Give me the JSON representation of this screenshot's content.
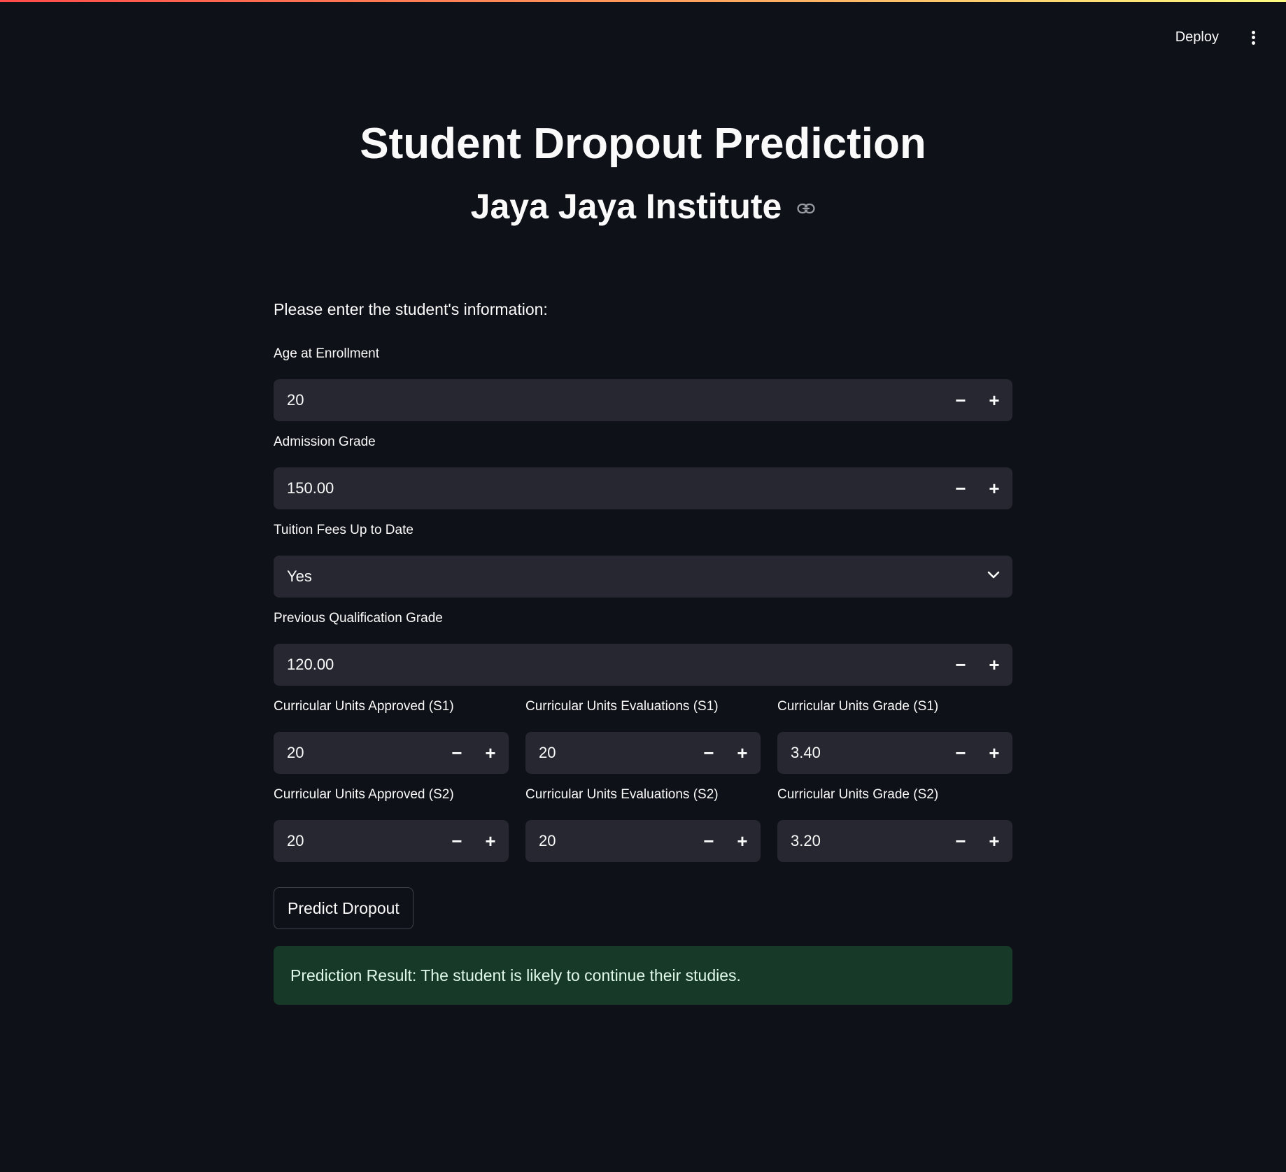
{
  "header": {
    "deploy_label": "Deploy",
    "menu_icon": "more-vertical-icon"
  },
  "page": {
    "title": "Student Dropout Prediction",
    "subtitle": "Jaya Jaya Institute",
    "intro": "Please enter the student's information:"
  },
  "fields": {
    "age": {
      "label": "Age at Enrollment",
      "value": "20"
    },
    "admission_grade": {
      "label": "Admission Grade",
      "value": "150.00"
    },
    "tuition": {
      "label": "Tuition Fees Up to Date",
      "value": "Yes"
    },
    "prev_qual": {
      "label": "Previous Qualification Grade",
      "value": "120.00"
    },
    "cu_approved_s1": {
      "label": "Curricular Units Approved (S1)",
      "value": "20"
    },
    "cu_eval_s1": {
      "label": "Curricular Units Evaluations (S1)",
      "value": "20"
    },
    "cu_grade_s1": {
      "label": "Curricular Units Grade (S1)",
      "value": "3.40"
    },
    "cu_approved_s2": {
      "label": "Curricular Units Approved (S2)",
      "value": "20"
    },
    "cu_eval_s2": {
      "label": "Curricular Units Evaluations (S2)",
      "value": "20"
    },
    "cu_grade_s2": {
      "label": "Curricular Units Grade (S2)",
      "value": "3.20"
    }
  },
  "stepper": {
    "minus": "−",
    "plus": "+"
  },
  "actions": {
    "predict_label": "Predict Dropout"
  },
  "result": {
    "text": "Prediction Result: The student is likely to continue their studies."
  },
  "colors": {
    "background": "#0e1117",
    "input_bg": "#262730",
    "success_bg": "#173928",
    "accent_gradient_start": "#ff4b4b",
    "accent_gradient_end": "#fffd80"
  }
}
